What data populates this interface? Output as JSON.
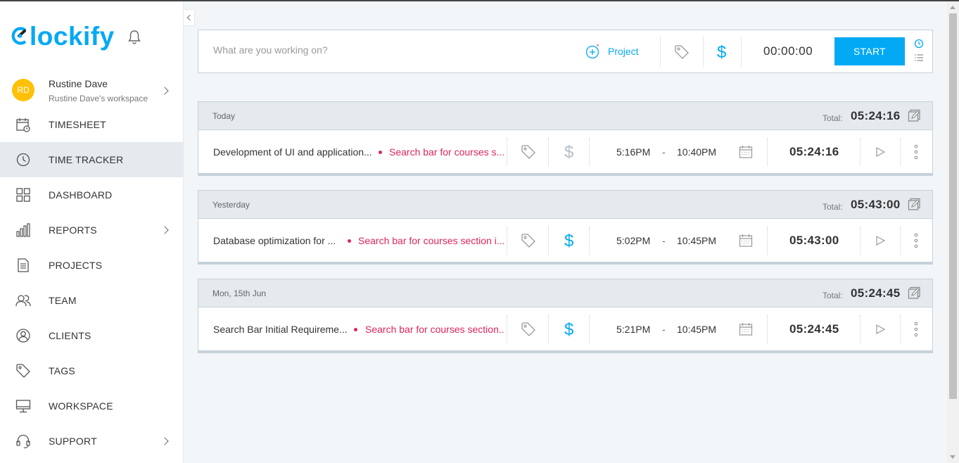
{
  "app": {
    "logo_text": "lockify",
    "brand_color": "#03a9f4"
  },
  "user": {
    "initials": "RD",
    "name": "Rustine Dave",
    "workspace": "Rustine Dave's workspace",
    "avatar_color": "#ffc107"
  },
  "nav": {
    "items": [
      {
        "label": "TIMESHEET",
        "icon": "timesheet-icon"
      },
      {
        "label": "TIME TRACKER",
        "icon": "clock-icon",
        "active": true
      },
      {
        "label": "DASHBOARD",
        "icon": "dashboard-grid-icon"
      },
      {
        "label": "REPORTS",
        "icon": "bar-chart-icon",
        "has_submenu": true
      },
      {
        "label": "PROJECTS",
        "icon": "document-icon"
      },
      {
        "label": "TEAM",
        "icon": "team-icon"
      },
      {
        "label": "CLIENTS",
        "icon": "client-icon"
      },
      {
        "label": "TAGS",
        "icon": "tag-icon"
      },
      {
        "label": "WORKSPACE",
        "icon": "monitor-icon"
      },
      {
        "label": "SUPPORT",
        "icon": "headset-icon",
        "has_submenu": true
      }
    ]
  },
  "tracker": {
    "placeholder": "What are you working on?",
    "project_label": "Project",
    "timer": "00:00:00",
    "start_label": "START"
  },
  "groups": [
    {
      "day": "Today",
      "total_label": "Total:",
      "total": "05:24:16",
      "entry": {
        "description": "Development of UI and application...",
        "project": "Search bar for courses s...",
        "billable": false,
        "start": "5:16PM",
        "dash": "-",
        "end": "10:40PM",
        "duration": "05:24:16"
      }
    },
    {
      "day": "Yesterday",
      "total_label": "Total:",
      "total": "05:43:00",
      "entry": {
        "description": "Database optimization for ...",
        "project": "Search bar for courses section i...",
        "billable": true,
        "start": "5:02PM",
        "dash": "-",
        "end": "10:45PM",
        "duration": "05:43:00"
      }
    },
    {
      "day": "Mon, 15th Jun",
      "total_label": "Total:",
      "total": "05:24:45",
      "entry": {
        "description": "Search Bar Initial Requireme...",
        "project": "Search bar for courses section...",
        "billable": true,
        "start": "5:21PM",
        "dash": "-",
        "end": "10:45PM",
        "duration": "05:24:45"
      }
    }
  ],
  "colors": {
    "project_red": "#e0245e",
    "billable_blue": "#03a9f4",
    "inactive_gray": "#b5bec4"
  }
}
